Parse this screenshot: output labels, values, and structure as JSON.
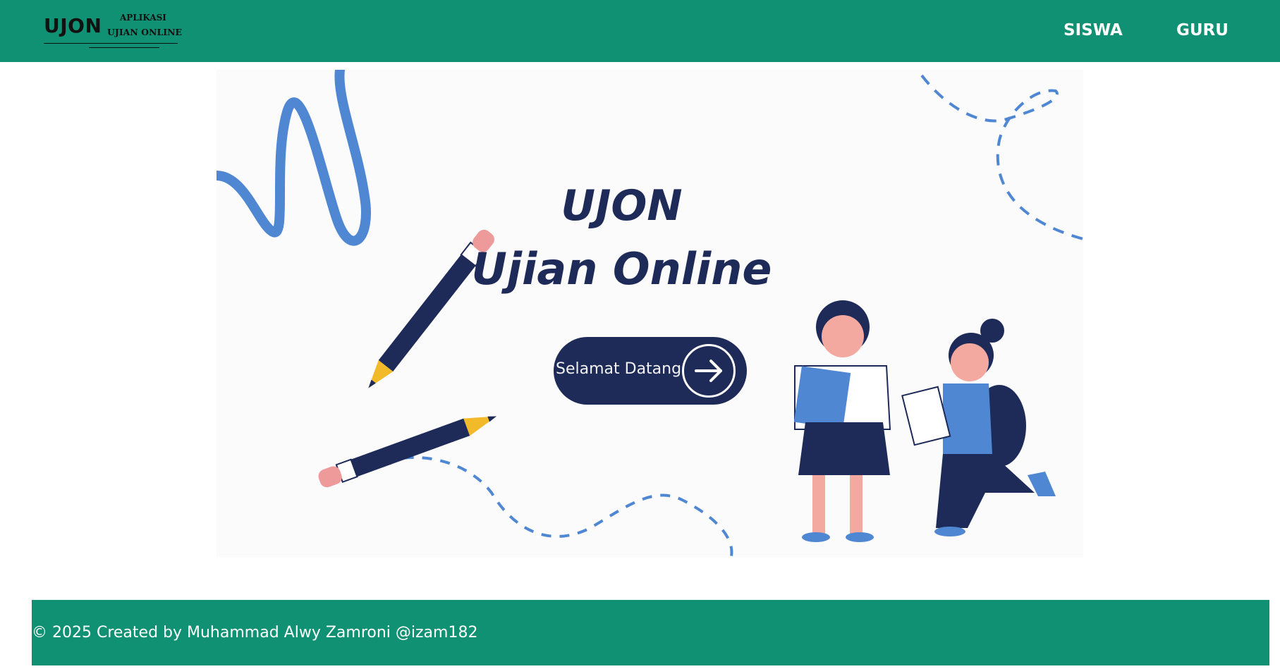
{
  "navbar": {
    "logo": {
      "main": "UJON",
      "line1": "APLIKASI",
      "line2": "UJIAN ONLINE"
    },
    "links": [
      "SISWA",
      "GURU"
    ],
    "background_color": "#119173"
  },
  "banner": {
    "title_line1": "UJON",
    "title_line2": "Ujian Online",
    "button_label": "Selamat Datang",
    "button_icon": "arrow-right-icon",
    "text_color": "#1e2a57"
  },
  "footer": {
    "text": "© 2025 Created by Muhammad Alwy Zamroni @izam182",
    "background_color": "#119173"
  }
}
